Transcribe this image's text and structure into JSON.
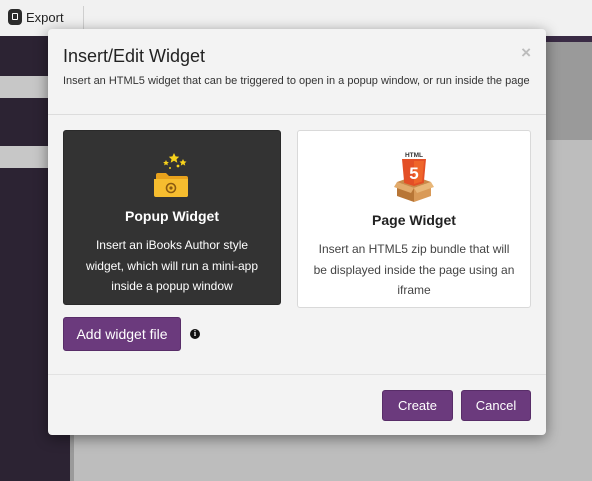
{
  "toolbar": {
    "export_label": "Export"
  },
  "modal": {
    "title": "Insert/Edit Widget",
    "subtitle": "Insert an HTML5 widget that can be triggered to open in a popup window, or run inside the page",
    "close_glyph": "×",
    "cards": [
      {
        "icon": "folder-stars-icon",
        "title": "Popup Widget",
        "description": "Insert an iBooks Author style widget, which will run a mini-app inside a popup window"
      },
      {
        "icon": "html5-box-icon",
        "icon_label": "HTML",
        "icon_number": "5",
        "title": "Page Widget",
        "description": "Insert an HTML5 zip bundle that will be displayed inside the page using an iframe"
      }
    ],
    "add_button_label": "Add widget file",
    "info_glyph": "i",
    "create_label": "Create",
    "cancel_label": "Cancel"
  },
  "colors": {
    "accent": "#6b3a7d",
    "selected_card": "#333333",
    "sidebar": "#2c2333"
  }
}
